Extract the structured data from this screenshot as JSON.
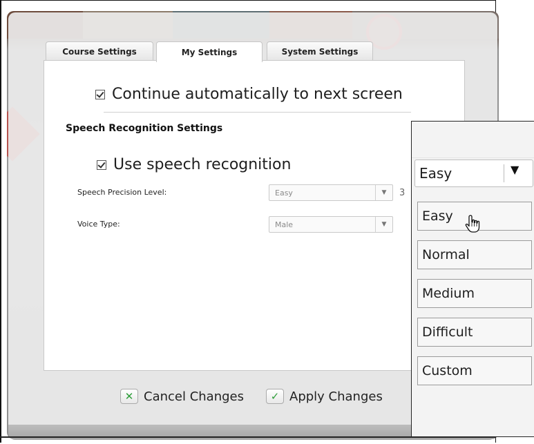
{
  "tabs": [
    {
      "label": "Course Settings",
      "active": false
    },
    {
      "label": "My Settings",
      "active": true
    },
    {
      "label": "System Settings",
      "active": false
    }
  ],
  "settings": {
    "continue_automatically": {
      "label": "Continue automatically to next screen",
      "checked": true
    },
    "speech_section_title": "Speech Recognition Settings",
    "use_speech": {
      "label": "Use speech recognition",
      "checked": true
    },
    "precision": {
      "label": "Speech Precision Level:",
      "value": "Easy",
      "level_number": "3"
    },
    "voice": {
      "label": "Voice Type:",
      "value": "Male"
    }
  },
  "footer": {
    "cancel_label": "Cancel Changes",
    "apply_label": "Apply Changes"
  },
  "inset": {
    "selected": "Easy",
    "options": [
      "Easy",
      "Normal",
      "Medium",
      "Difficult",
      "Custom"
    ],
    "hovered_option": "Easy"
  },
  "colors": {
    "cancel_icon": "#2e9e3a",
    "apply_icon": "#2e9e3a"
  },
  "icons": {
    "checkbox": "checkmark-icon",
    "dropdown_arrow": "triangle-down-icon",
    "cancel": "x-icon",
    "apply": "checkmark-icon",
    "cursor": "hand-pointer-icon"
  }
}
